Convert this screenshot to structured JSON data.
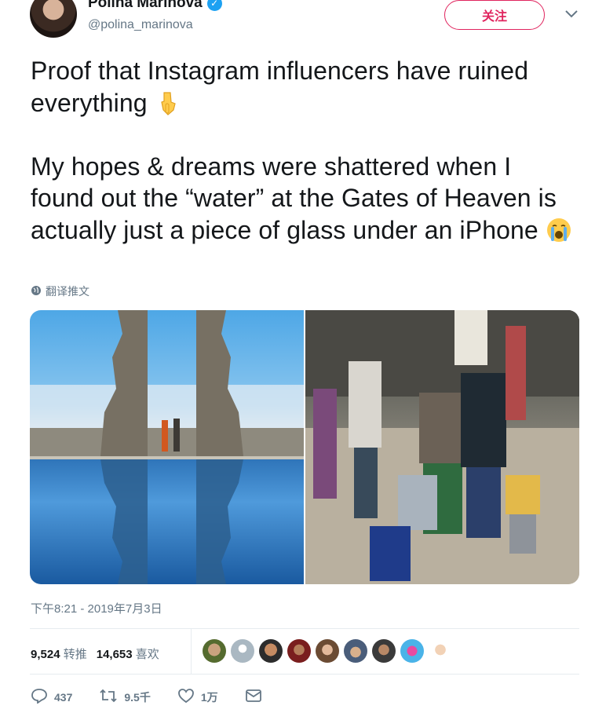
{
  "author": {
    "display_name": "Polina Marinova",
    "handle": "@polina_marinova",
    "verified_icon": "verified-badge-icon"
  },
  "header": {
    "follow_label": "关注",
    "menu_icon": "chevron-down-icon"
  },
  "tweet": {
    "text": "Proof that Instagram influencers have ruined everything\n\nMy hopes & dreams were shattered when I found out the “water” at the Gates of Heaven is actually just a piece of glass under an iPhone",
    "emoji_1": "pointing-down-emoji",
    "emoji_2": "crying-face-emoji",
    "translate_label": "翻译推文",
    "translate_icon": "globe-icon",
    "timestamp": "下午8:21 - 2019年7月3日"
  },
  "stats": {
    "retweets_value": "9,524",
    "retweets_label": "转推",
    "likes_value": "14,653",
    "likes_label": "喜欢"
  },
  "actions": {
    "reply_count": "437",
    "retweet_count": "9.5千",
    "like_count": "1万"
  },
  "colors": {
    "accent_follow": "#e0245e",
    "verified": "#1da1f2",
    "secondary_text": "#657786"
  }
}
